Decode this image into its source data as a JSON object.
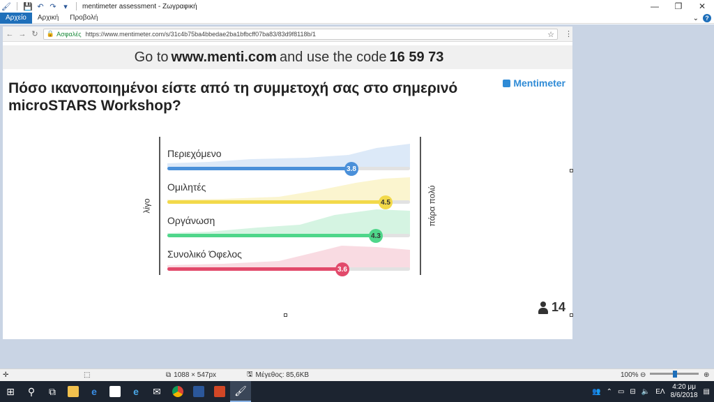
{
  "window": {
    "title": "mentimeter assessment - Ζωγραφική",
    "controls": {
      "minimize": "—",
      "maximize": "❐",
      "close": "✕"
    }
  },
  "ribbon": {
    "tabs": [
      {
        "label": "Αρχείο",
        "active": true
      },
      {
        "label": "Αρχική",
        "active": false
      },
      {
        "label": "Προβολή",
        "active": false
      }
    ],
    "help": "?"
  },
  "browser": {
    "secure_label": "Ασφαλές",
    "url": "https://www.mentimeter.com/s/31c4b75ba4bbedae2ba1bfbcff07ba83/83d9f8118b/1"
  },
  "menti": {
    "go_to": "Go to",
    "site": "www.menti.com",
    "and_use": "and use the code",
    "code": "16 59 73",
    "question": "Πόσο ικανοποιημένοι είστε από τη συμμετοχή σας στο σημερινό microSTARS Workshop?",
    "brand": "Mentimeter",
    "scale_low": "λίγο",
    "scale_high": "πάρα πολύ",
    "participants": "14",
    "items": [
      {
        "label": "Περιεχόμενο",
        "value": 3.8,
        "value_text": "3.8",
        "color": "#4a90d9",
        "light": "#dce9f8",
        "text_color": "#ffffff"
      },
      {
        "label": "Ομιλητές",
        "value": 4.5,
        "value_text": "4.5",
        "color": "#f2d94a",
        "light": "#fbf5cf",
        "text_color": "#333333"
      },
      {
        "label": "Οργάνωση",
        "value": 4.3,
        "value_text": "4.3",
        "color": "#4fd68a",
        "light": "#d5f4e2",
        "text_color": "#333333"
      },
      {
        "label": "Συνολικό Όφελος",
        "value": 3.6,
        "value_text": "3.6",
        "color": "#e24a6b",
        "light": "#f9dbe2",
        "text_color": "#ffffff"
      }
    ],
    "scale_max": 5
  },
  "statusbar": {
    "dimensions": "1088 × 547px",
    "size": "Μέγεθος: 85,6KB",
    "zoom": "100%"
  },
  "taskbar": {
    "language": "ΕΛ",
    "time": "4:20 μμ",
    "date": "8/6/2018"
  }
}
